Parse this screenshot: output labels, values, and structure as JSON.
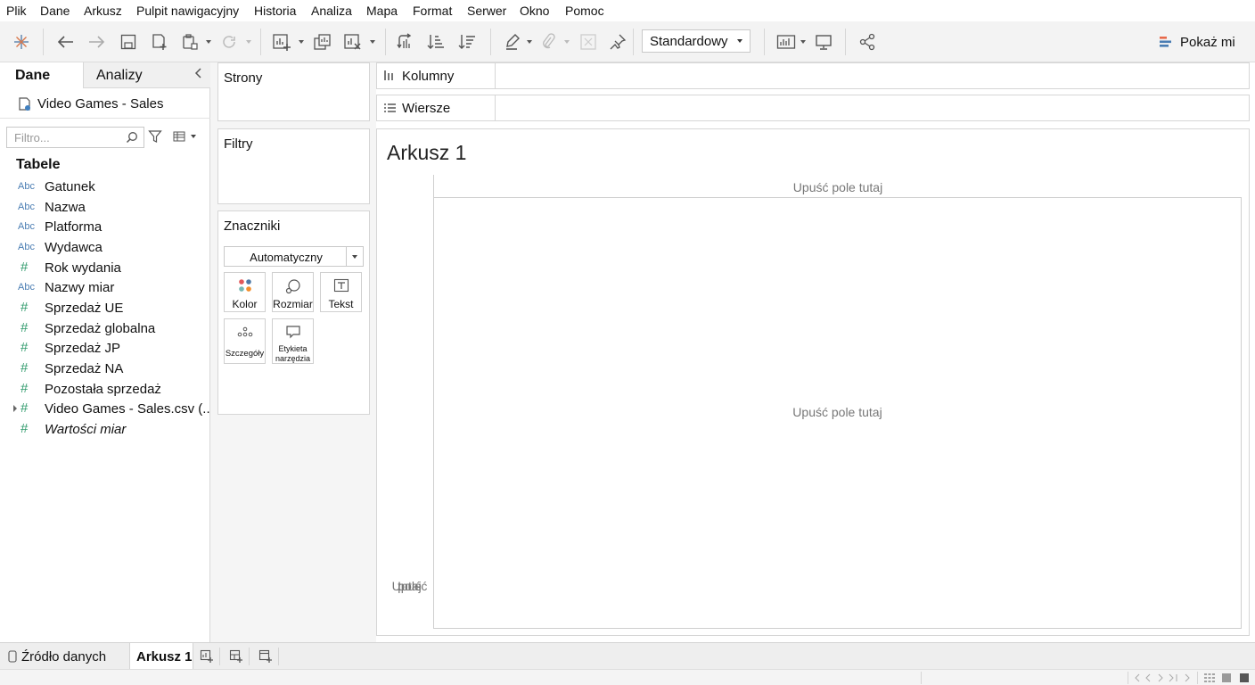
{
  "menu": [
    "Plik",
    "Dane",
    "Arkusz",
    "Pulpit nawigacyjny",
    "Historia",
    "Analiza",
    "Mapa",
    "Format",
    "Serwer",
    "Okno",
    "Pomoc"
  ],
  "toolbar": {
    "fit_value": "Standardowy",
    "show_me": "Pokaż mi"
  },
  "data_pane": {
    "tab_data": "Dane",
    "tab_analytics": "Analizy",
    "datasource": "Video Games - Sales",
    "search_placeholder": "Filtro...",
    "tables_heading": "Tabele",
    "fields": [
      {
        "type": "Abc",
        "name": "Gatunek"
      },
      {
        "type": "Abc",
        "name": "Nazwa"
      },
      {
        "type": "Abc",
        "name": "Platforma"
      },
      {
        "type": "Abc",
        "name": "Wydawca"
      },
      {
        "type": "#",
        "name": "Rok wydania"
      },
      {
        "type": "Abc",
        "name": "Nazwy miar"
      },
      {
        "type": "#",
        "name": "Sprzedaż UE"
      },
      {
        "type": "#",
        "name": "Sprzedaż globalna"
      },
      {
        "type": "#",
        "name": "Sprzedaż JP"
      },
      {
        "type": "#",
        "name": "Sprzedaż NA"
      },
      {
        "type": "#",
        "name": "Pozostała sprzedaż"
      },
      {
        "type": "#",
        "name": "Video Games - Sales.csv (..."
      },
      {
        "type": "#",
        "name": "Wartości miar"
      }
    ]
  },
  "cards": {
    "pages": "Strony",
    "filters": "Filtry",
    "marks": "Znaczniki",
    "marks_type": "Automatyczny",
    "marks_buttons": {
      "color": "Kolor",
      "size": "Rozmiar",
      "text": "Tekst",
      "detail": "Szczegóły",
      "tooltip_1": "Etykieta",
      "tooltip_2": "narzędzia"
    }
  },
  "shelves": {
    "columns": "Kolumny",
    "rows": "Wiersze"
  },
  "worksheet": {
    "title": "Arkusz 1",
    "drop_columns": "Upuść pole tutaj",
    "drop_rows_1": "Upuść",
    "drop_rows_2": "pole",
    "drop_rows_3": "tutaj",
    "drop_canvas": "Upuść pole tutaj"
  },
  "tabs": {
    "data_source": "Źródło danych",
    "sheet": "Arkusz 1"
  },
  "colors": {
    "abc_type": "#4a7db3",
    "measure_type": "#2f9a6b",
    "show_me_accent": "#e8694a"
  }
}
